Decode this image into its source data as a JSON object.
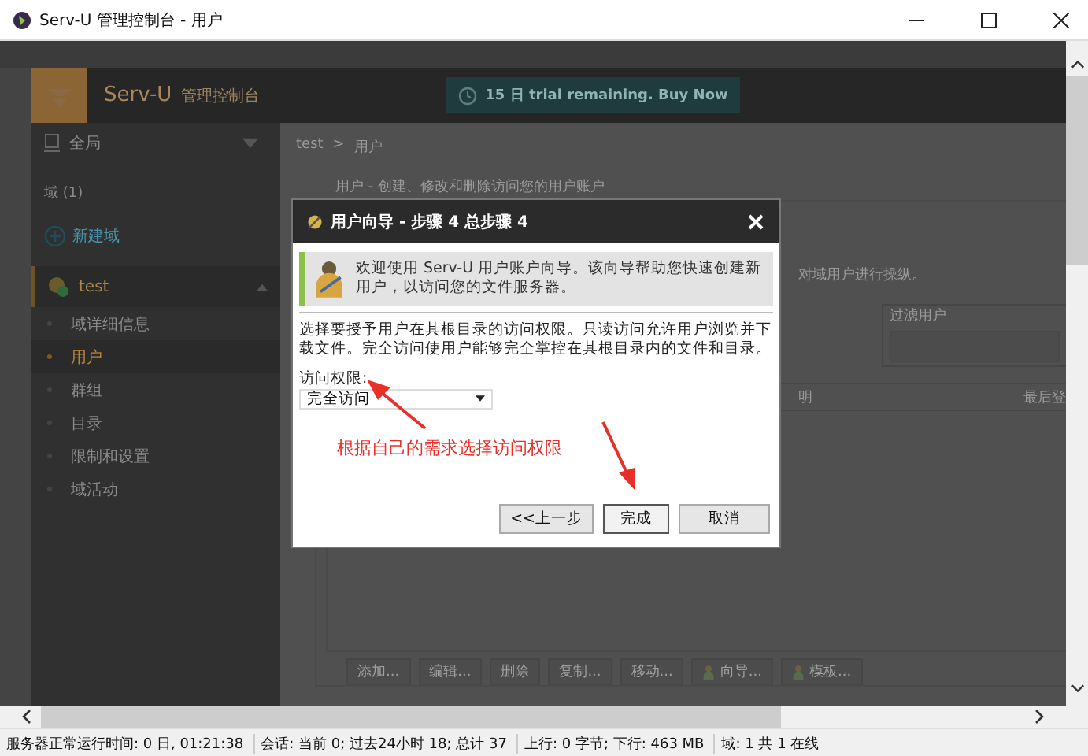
{
  "window": {
    "title": "Serv-U 管理控制台 - 用户"
  },
  "header": {
    "brand": "Serv-U",
    "subtitle": "管理控制台",
    "trial": "15 日 trial remaining. Buy Now"
  },
  "sidebar": {
    "scope": "全局",
    "section": "域 (1)",
    "new_domain": "新建域",
    "domain": {
      "label": "test",
      "expanded": true,
      "selected": true
    },
    "items": [
      {
        "label": "域详细信息",
        "selected": false
      },
      {
        "label": "用户",
        "selected": true
      },
      {
        "label": "群组",
        "selected": false
      },
      {
        "label": "目录",
        "selected": false
      },
      {
        "label": "限制和设置",
        "selected": false
      },
      {
        "label": "域活动",
        "selected": false
      }
    ]
  },
  "main": {
    "breadcrumb": [
      "test",
      ">",
      "用户"
    ],
    "heading": "用户 - 创建、修改和删除访问您的用户账户",
    "note": "对域用户进行操纵。",
    "filter_label": "过滤用户",
    "columns": [
      "明",
      "最后登"
    ],
    "buttons": [
      {
        "label": "添加...",
        "kind": "plain"
      },
      {
        "label": "编辑...",
        "kind": "plain"
      },
      {
        "label": "删除",
        "kind": "plain"
      },
      {
        "label": "复制...",
        "kind": "plain"
      },
      {
        "label": "移动...",
        "kind": "plain"
      },
      {
        "label": "向导...",
        "kind": "person"
      },
      {
        "label": "模板...",
        "kind": "person"
      }
    ]
  },
  "dialog": {
    "title": "用户向导 - 步骤 4 总步骤 4",
    "intro": "欢迎使用 Serv-U 用户账户向导。该向导帮助您快速创建新用户，以访问您的文件服务器。",
    "description": "选择要授予用户在其根目录的访问权限。只读访问允许用户浏览并下载文件。完全访问使用户能够完全掌控在其根目录内的文件和目录。",
    "field_label": "访问权限:",
    "field_value": "完全访问",
    "buttons": [
      {
        "label": "<<上一步",
        "selected": false
      },
      {
        "label": "完成",
        "selected": true
      },
      {
        "label": "取消",
        "selected": false
      }
    ]
  },
  "annotation": "根据自己的需求选择访问权限",
  "status_bar": [
    "服务器正常运行时间: 0 日, 01:21:38",
    "会话: 当前 0; 过去24小时 18; 总计 37",
    "上行: 0 字节; 下行: 463 MB",
    "域: 1 共 1 在线"
  ]
}
